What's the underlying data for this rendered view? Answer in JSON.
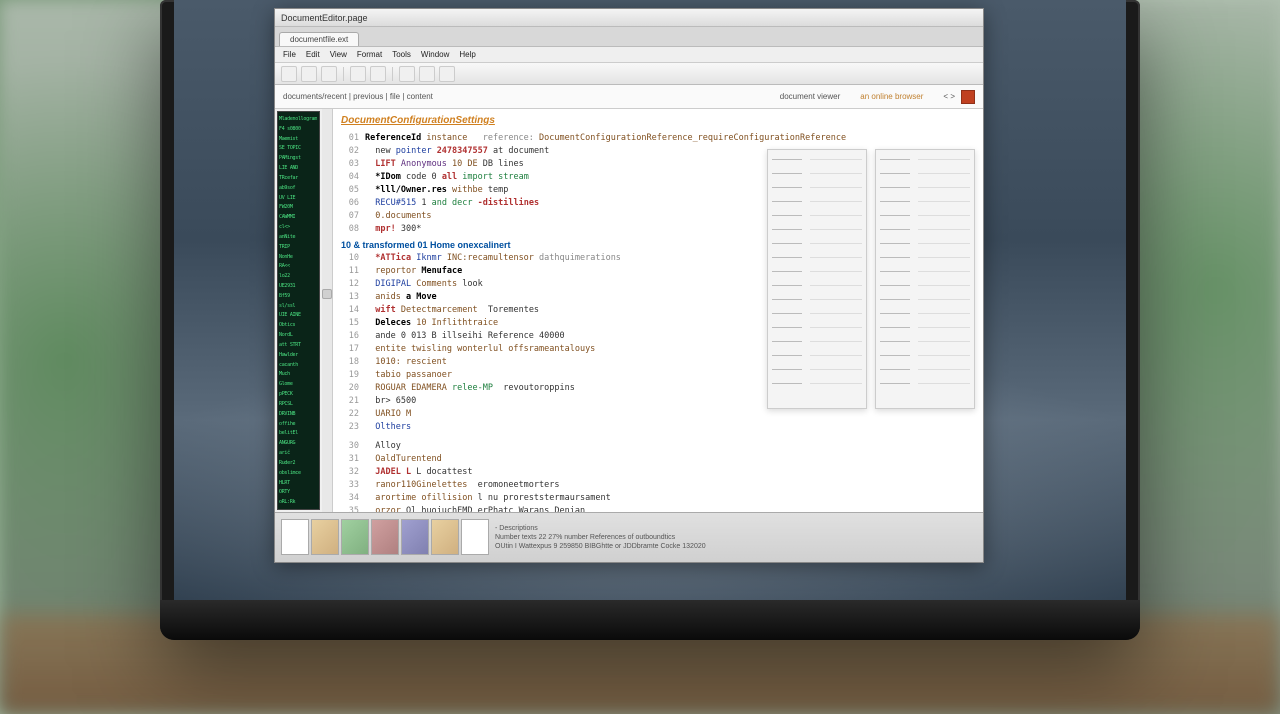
{
  "window": {
    "title": "DocumentEditor.page"
  },
  "tab": {
    "label": "documentfile.ext"
  },
  "menu": {
    "items": [
      "File",
      "Edit",
      "View",
      "Format",
      "Tools",
      "Window",
      "Help"
    ]
  },
  "headerbar": {
    "path": "documents/recent | previous | file | content",
    "section_label": "document viewer",
    "label2": "an online browser",
    "nav": "< >"
  },
  "code": {
    "heading": "DocumentConfigurationSettings",
    "line1": {
      "n": "01",
      "a": "ReferenceId",
      "b": "instance",
      "c": "reference:",
      "d": "DocumentConfigurationReference_requireConfigurationReference"
    },
    "line2": {
      "n": "02",
      "a": "new",
      "b": "pointer",
      "c": "2478347557",
      "d": "at document"
    },
    "line3": {
      "n": "03",
      "a": "LIFT",
      "b": "Anonymous",
      "c": "10 DE",
      "d": "DB lines"
    },
    "line4": {
      "n": "04",
      "a": "*IDom",
      "b": "code 0",
      "c": "all",
      "d": "import stream"
    },
    "line5": {
      "n": "05",
      "a": "*lll/Owner.res",
      "b": "withbe",
      "c": "temp"
    },
    "line6": {
      "n": "06",
      "a": "RECU#515",
      "b": "1",
      "c": "and decr",
      "d": "-distillines"
    },
    "line7": {
      "n": "07",
      "a": "0.documents"
    },
    "line8": {
      "n": "08",
      "a": "mpr!",
      "b": "300*"
    },
    "section2": "10 & transformed 01 Home onexcalinert",
    "line10": {
      "n": "10",
      "a": "*ATTica",
      "b": "Iknmr",
      "c": "INC:recamultensor",
      "d": "dathquimerations"
    },
    "line11": {
      "n": "11",
      "a": "reportor",
      "b": "Menuface"
    },
    "line12": {
      "n": "12",
      "a": "DIGIPAL",
      "b": "Comments",
      "c": "look"
    },
    "line13": {
      "n": "13",
      "a": "anids",
      "b": "a Move"
    },
    "line14": {
      "n": "14",
      "a": "wift",
      "b": "Detectmarcement",
      "c": "Torementes"
    },
    "line15": {
      "n": "15",
      "a": "Deleces",
      "b": "10 Inflithtraice"
    },
    "line16": {
      "n": "16",
      "a": "ande  0 013 B illseihi  Reference  40000"
    },
    "line17": {
      "n": "17",
      "a": "entite  twisling  wonterlul  offsrameantalouys"
    },
    "line18": {
      "n": "18",
      "a": "1010: rescient"
    },
    "line19": {
      "n": "19",
      "a": "tabio passanoer"
    },
    "line20": {
      "n": "20",
      "a": "ROGUAR EDAMERA",
      "b": "relee-MP",
      "c": "revoutoroppins"
    },
    "line21": {
      "n": "21",
      "a": "br> 6500"
    },
    "line22": {
      "n": "22",
      "a": "UARIO M"
    },
    "line23": {
      "n": "23",
      "a": "Olthers"
    },
    "line30": {
      "n": "30",
      "a": "Alloy"
    },
    "line31": {
      "n": "31",
      "a": "OaldTurentend"
    },
    "line32": {
      "n": "32",
      "a": "JADEL L",
      "b": "L docattest"
    },
    "line33": {
      "n": "33",
      "a": "ranor110Ginelettes",
      "b": "eromoneetmorters"
    },
    "line34": {
      "n": "34",
      "a": "arortime",
      "b": "ofillision",
      "c": "l nu proreststermaursament"
    },
    "line35": {
      "n": "35",
      "a": "orzor",
      "b": "Ol huojuchEMD",
      "c": "erPhatc Warans Denian"
    }
  },
  "minimap": {
    "lines": [
      "Mladenollogram",
      "F4 s0800",
      "Maemist",
      "SE TOPIC",
      "PAMingst",
      "LIE AND",
      "TRcefar",
      "ab9sof",
      "UV  LIE",
      "FW20M",
      "CAWMMI",
      "cl<>",
      "anNite",
      "TRIP",
      "NonHe",
      "RA<<",
      "lo22",
      "UE2931",
      "Bf59",
      "sl/ssl",
      "UIE AINE",
      "Obtics",
      "NordL",
      "att STRT",
      "Hawlder",
      "cacanth",
      "Much",
      "Glome",
      "pPECK",
      "RPCSL",
      "DRVINB",
      "offihe",
      "belitEl",
      "ANGURG",
      "arič",
      "Ruder2",
      "obslimce",
      "HLRT",
      "ORTY",
      "oRL:Rk"
    ]
  },
  "status": {
    "line1": "- Descriptions",
    "line2": "Number texts  22 27% number References  of outboundtics",
    "bottom": "OUtin I Wattexpus 9 259850 BIBGhtte or JDDbramte Cocke 132020"
  }
}
